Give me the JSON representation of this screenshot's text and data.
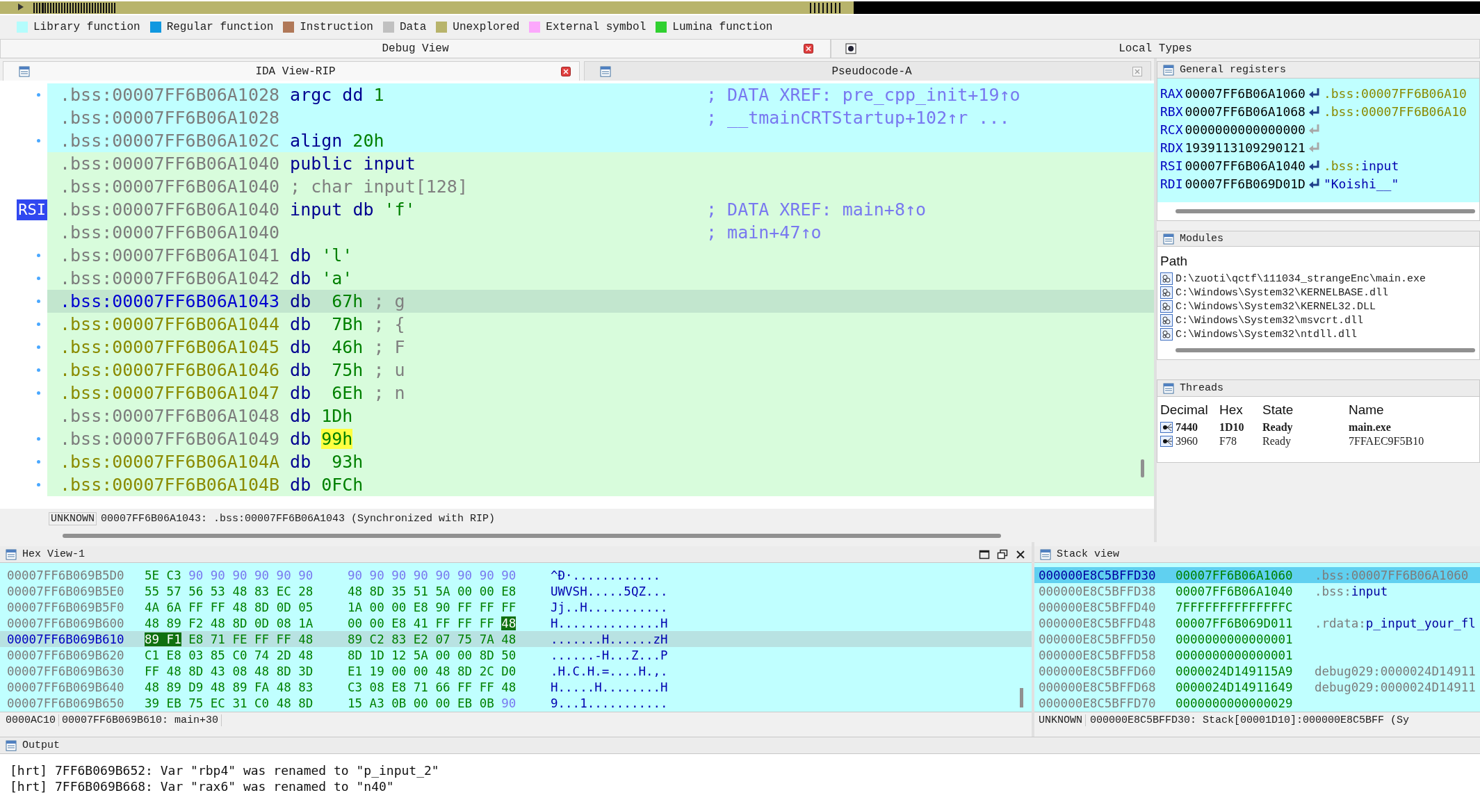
{
  "legend": [
    {
      "label": "Library function",
      "color": "#b4fcfc"
    },
    {
      "label": "Regular function",
      "color": "#1098e0"
    },
    {
      "label": "Instruction",
      "color": "#b07858"
    },
    {
      "label": "Data",
      "color": "#c0c0c0"
    },
    {
      "label": "Unexplored",
      "color": "#b8b46c"
    },
    {
      "label": "External symbol",
      "color": "#fca8fc"
    },
    {
      "label": "Lumina function",
      "color": "#30d030"
    }
  ],
  "main_tabs": [
    {
      "label": "Debug View",
      "selected": true
    },
    {
      "label": "Local Types",
      "selected": false
    }
  ],
  "ida_view": {
    "tabs": [
      {
        "label": "IDA View-RIP",
        "selected": true
      },
      {
        "label": "Pseudocode-A",
        "selected": false
      }
    ],
    "lines": [
      {
        "address": ".bss:00007FF6B06A1028",
        "defined": false,
        "library": true,
        "dot": true,
        "selected": false,
        "tokens": [
          {
            "text": "argc dd",
            "kind": "keyword"
          },
          {
            "text": "1",
            "kind": "number"
          }
        ],
        "xref": "; DATA XREF: pre_cpp_init+19↑o"
      },
      {
        "address": ".bss:00007FF6B06A1028",
        "defined": false,
        "library": true,
        "dot": false,
        "selected": false,
        "xref": "; __tmainCRTStartup+102↑r ..."
      },
      {
        "address": ".bss:00007FF6B06A102C",
        "defined": false,
        "library": true,
        "dot": true,
        "selected": false,
        "tokens": [
          {
            "text": "align",
            "kind": "keyword"
          },
          {
            "text": "20h",
            "kind": "number"
          }
        ]
      },
      {
        "address": ".bss:00007FF6B06A1040",
        "defined": false,
        "library": false,
        "dot": false,
        "selected": false,
        "tokens": [
          {
            "text": "public input",
            "kind": "keyword"
          }
        ]
      },
      {
        "address": ".bss:00007FF6B06A1040",
        "defined": false,
        "library": false,
        "dot": false,
        "selected": false,
        "tokens": [
          {
            "text": "; char input[128]",
            "kind": "comment"
          }
        ]
      },
      {
        "address": ".bss:00007FF6B06A1040",
        "defined": false,
        "library": false,
        "dot": false,
        "register_tag": "RSI",
        "selected": false,
        "tokens": [
          {
            "text": "input db",
            "kind": "keyword"
          },
          {
            "text": "'f'",
            "kind": "number"
          }
        ],
        "xref": "; DATA XREF: main+8↑o"
      },
      {
        "address": ".bss:00007FF6B06A1040",
        "defined": false,
        "library": false,
        "dot": false,
        "selected": false,
        "xref": "; main+47↑o"
      },
      {
        "address": ".bss:00007FF6B06A1041",
        "defined": false,
        "library": false,
        "dot": true,
        "selected": false,
        "tokens": [
          {
            "text": "db",
            "kind": "keyword"
          },
          {
            "text": "'l'",
            "kind": "number"
          }
        ]
      },
      {
        "address": ".bss:00007FF6B06A1042",
        "defined": false,
        "library": false,
        "dot": true,
        "selected": false,
        "tokens": [
          {
            "text": "db",
            "kind": "keyword"
          },
          {
            "text": "'a'",
            "kind": "number"
          }
        ]
      },
      {
        "address": ".bss:00007FF6B06A1043",
        "dot": true,
        "selected": true,
        "tokens": [
          {
            "text": "db",
            "kind": "keyword"
          },
          {
            "text": " 67h",
            "kind": "number"
          },
          {
            "text": "; g",
            "kind": "comment"
          }
        ]
      },
      {
        "address": ".bss:00007FF6B06A1044",
        "defined": true,
        "library": false,
        "dot": true,
        "selected": false,
        "tokens": [
          {
            "text": "db",
            "kind": "keyword"
          },
          {
            "text": " 7Bh",
            "kind": "number"
          },
          {
            "text": "; {",
            "kind": "comment"
          }
        ]
      },
      {
        "address": ".bss:00007FF6B06A1045",
        "defined": true,
        "library": false,
        "dot": true,
        "selected": false,
        "tokens": [
          {
            "text": "db",
            "kind": "keyword"
          },
          {
            "text": " 46h",
            "kind": "number"
          },
          {
            "text": "; F",
            "kind": "comment"
          }
        ]
      },
      {
        "address": ".bss:00007FF6B06A1046",
        "defined": true,
        "library": false,
        "dot": true,
        "selected": false,
        "tokens": [
          {
            "text": "db",
            "kind": "keyword"
          },
          {
            "text": " 75h",
            "kind": "number"
          },
          {
            "text": "; u",
            "kind": "comment"
          }
        ]
      },
      {
        "address": ".bss:00007FF6B06A1047",
        "defined": true,
        "library": false,
        "dot": true,
        "selected": false,
        "tokens": [
          {
            "text": "db",
            "kind": "keyword"
          },
          {
            "text": " 6Eh",
            "kind": "number"
          },
          {
            "text": "; n",
            "kind": "comment"
          }
        ]
      },
      {
        "address": ".bss:00007FF6B06A1048",
        "defined": false,
        "library": false,
        "dot": false,
        "selected": false,
        "tokens": [
          {
            "text": "db",
            "kind": "keyword"
          },
          {
            "text": "1Dh",
            "kind": "number"
          }
        ]
      },
      {
        "address": ".bss:00007FF6B06A1049",
        "defined": false,
        "library": false,
        "dot": true,
        "selected": false,
        "tokens": [
          {
            "text": "db",
            "kind": "keyword"
          },
          {
            "text": "99h",
            "kind": "highlight"
          }
        ]
      },
      {
        "address": ".bss:00007FF6B06A104A",
        "defined": true,
        "library": false,
        "dot": true,
        "selected": false,
        "tokens": [
          {
            "text": "db",
            "kind": "keyword"
          },
          {
            "text": " 93h",
            "kind": "number"
          }
        ]
      },
      {
        "address": ".bss:00007FF6B06A104B",
        "defined": true,
        "library": false,
        "dot": true,
        "selected": false,
        "tokens": [
          {
            "text": "db",
            "kind": "keyword"
          },
          {
            "text": "0FCh",
            "kind": "number"
          }
        ]
      }
    ],
    "status": {
      "label": "UNKNOWN",
      "text": "00007FF6B06A1043: .bss:00007FF6B06A1043 (Synchronized with RIP)"
    }
  },
  "registers": {
    "title": "General registers",
    "rows": [
      {
        "name": "RAX",
        "value": "00007FF6B06A1060",
        "pointer": true,
        "comment": [
          {
            "text": ".bss:00007FF6B06A10",
            "kind": "address"
          }
        ]
      },
      {
        "name": "RBX",
        "value": "00007FF6B06A1068",
        "pointer": true,
        "comment": [
          {
            "text": ".bss:00007FF6B06A10",
            "kind": "address"
          }
        ]
      },
      {
        "name": "RCX",
        "value": "0000000000000000",
        "pointer": false
      },
      {
        "name": "RDX",
        "value": "1939113109290121",
        "pointer": false
      },
      {
        "name": "RSI",
        "value": "00007FF6B06A1040",
        "pointer": true,
        "comment": [
          {
            "text": ".bss:",
            "kind": "segment"
          },
          {
            "text": "input",
            "kind": "name"
          }
        ]
      },
      {
        "name": "RDI",
        "value": "00007FF6B069D01D",
        "pointer": true,
        "comment": [
          {
            "text": "\"Koishi__\"",
            "kind": "name"
          }
        ]
      }
    ]
  },
  "modules": {
    "title": "Modules",
    "column": "Path",
    "paths": [
      "D:\\zuoti\\qctf\\111034_strangeEnc\\main.exe",
      "C:\\Windows\\System32\\KERNELBASE.dll",
      "C:\\Windows\\System32\\KERNEL32.DLL",
      "C:\\Windows\\System32\\msvcrt.dll",
      "C:\\Windows\\System32\\ntdll.dll"
    ]
  },
  "threads": {
    "title": "Threads",
    "columns": [
      "Decimal",
      "Hex",
      "State",
      "Name"
    ],
    "rows": [
      {
        "cells": [
          "7440",
          "1D10",
          "Ready",
          "main.exe"
        ],
        "current": true
      },
      {
        "cells": [
          "3960",
          "F78",
          "Ready",
          "7FFAEC9F5B10"
        ],
        "current": false
      }
    ]
  },
  "hex_view": {
    "title": "Hex View-1",
    "rows": [
      {
        "address": "00007FF6B069B5D0",
        "selected": false,
        "groups": [
          [
            {
              "text": "5E C3",
              "kind": "plain"
            },
            {
              "text": "90 90 90 90 90 90",
              "kind": "dim"
            }
          ],
          [
            {
              "text": "90 90 90 90 90 90 90 90",
              "kind": "dim"
            }
          ]
        ],
        "ascii": "^Đ·............"
      },
      {
        "address": "00007FF6B069B5E0",
        "selected": false,
        "groups": [
          [
            {
              "text": "55 57 56 53 48 83 EC 28",
              "kind": "plain"
            }
          ],
          [
            {
              "text": "48 8D 35 51 5A 00 00 E8",
              "kind": "plain"
            }
          ]
        ],
        "ascii": "UWVSH.....5QZ..."
      },
      {
        "address": "00007FF6B069B5F0",
        "selected": false,
        "groups": [
          [
            {
              "text": "4A 6A FF FF 48 8D 0D 05",
              "kind": "plain"
            }
          ],
          [
            {
              "text": "1A 00 00 E8 90 FF FF FF",
              "kind": "plain"
            }
          ]
        ],
        "ascii": "Jj..H..........."
      },
      {
        "address": "00007FF6B069B600",
        "selected": false,
        "groups": [
          [
            {
              "text": "48 89 F2 48 8D 0D 08 1A",
              "kind": "plain"
            }
          ],
          [
            {
              "text": "00 00 E8 41 FF FF FF",
              "kind": "plain"
            },
            {
              "text": "48",
              "kind": "cursor"
            }
          ]
        ],
        "ascii": "H..............H"
      },
      {
        "address": "00007FF6B069B610",
        "selected": true,
        "groups": [
          [
            {
              "text": "89 F1",
              "kind": "cursor"
            },
            {
              "text": "E8 71 FE FF FF 48",
              "kind": "plain"
            }
          ],
          [
            {
              "text": "89 C2 83 E2 07 75 7A 48",
              "kind": "plain"
            }
          ]
        ],
        "ascii": ".......H......zH"
      },
      {
        "address": "00007FF6B069B620",
        "selected": false,
        "groups": [
          [
            {
              "text": "C1 E8 03 85 C0 74 2D 48",
              "kind": "plain"
            }
          ],
          [
            {
              "text": "8D 1D 12 5A 00 00 8D 50",
              "kind": "plain"
            }
          ]
        ],
        "ascii": "......-H...Z...P"
      },
      {
        "address": "00007FF6B069B630",
        "selected": false,
        "groups": [
          [
            {
              "text": "FF 48 8D 43 08 48 8D 3D",
              "kind": "plain"
            }
          ],
          [
            {
              "text": "E1 19 00 00 48 8D 2C D0",
              "kind": "plain"
            }
          ]
        ],
        "ascii": ".H.C.H.=....H.,."
      },
      {
        "address": "00007FF6B069B640",
        "selected": false,
        "groups": [
          [
            {
              "text": "48 89 D9 48 89 FA 48 83",
              "kind": "plain"
            }
          ],
          [
            {
              "text": "C3 08 E8 71 66 FF FF 48",
              "kind": "plain"
            }
          ]
        ],
        "ascii": "H.....H........H"
      },
      {
        "address": "00007FF6B069B650",
        "selected": false,
        "groups": [
          [
            {
              "text": "39 EB 75 EC 31 C0 48 8D",
              "kind": "plain"
            }
          ],
          [
            {
              "text": "15 A3 0B 00 00 EB 0B",
              "kind": "plain"
            },
            {
              "text": "90",
              "kind": "dim"
            }
          ]
        ],
        "ascii": "9...1..........."
      }
    ],
    "status": {
      "offset": "0000AC10",
      "text": "00007FF6B069B610: main+30"
    }
  },
  "stack_view": {
    "title": "Stack view",
    "rows": [
      {
        "address": "000000E8C5BFFD30",
        "value": "00007FF6B06A1060",
        "selected": true,
        "label": [
          {
            "text": ".bss:00007FF6B06A1060",
            "kind": "segment"
          }
        ]
      },
      {
        "address": "000000E8C5BFFD38",
        "value": "00007FF6B06A1040",
        "selected": false,
        "label": [
          {
            "text": ".bss:",
            "kind": "segment"
          },
          {
            "text": "input",
            "kind": "name"
          }
        ]
      },
      {
        "address": "000000E8C5BFFD40",
        "value": "7FFFFFFFFFFFFFFC",
        "selected": false
      },
      {
        "address": "000000E8C5BFFD48",
        "value": "00007FF6B069D011",
        "selected": false,
        "label": [
          {
            "text": ".rdata:",
            "kind": "segment"
          },
          {
            "text": "p_input_your_fl",
            "kind": "name"
          }
        ]
      },
      {
        "address": "000000E8C5BFFD50",
        "value": "0000000000000001",
        "selected": false
      },
      {
        "address": "000000E8C5BFFD58",
        "value": "0000000000000001",
        "selected": false
      },
      {
        "address": "000000E8C5BFFD60",
        "value": "0000024D149115A9",
        "selected": false,
        "label": [
          {
            "text": "debug029:0000024D14911",
            "kind": "segment"
          }
        ]
      },
      {
        "address": "000000E8C5BFFD68",
        "value": "0000024D14911649",
        "selected": false,
        "label": [
          {
            "text": "debug029:0000024D14911",
            "kind": "segment"
          }
        ]
      },
      {
        "address": "000000E8C5BFFD70",
        "value": "0000000000000029",
        "selected": false
      }
    ],
    "status": {
      "label": "UNKNOWN",
      "text": "000000E8C5BFFD30: Stack[00001D10]:000000E8C5BFF (Sy"
    }
  },
  "output": {
    "title": "Output",
    "lines": [
      "[hrt] 7FF6B069B652: Var \"rbp4\" was renamed to \"p_input_2\"",
      "[hrt] 7FF6B069B668: Var \"rax6\" was renamed to \"n40\""
    ]
  }
}
